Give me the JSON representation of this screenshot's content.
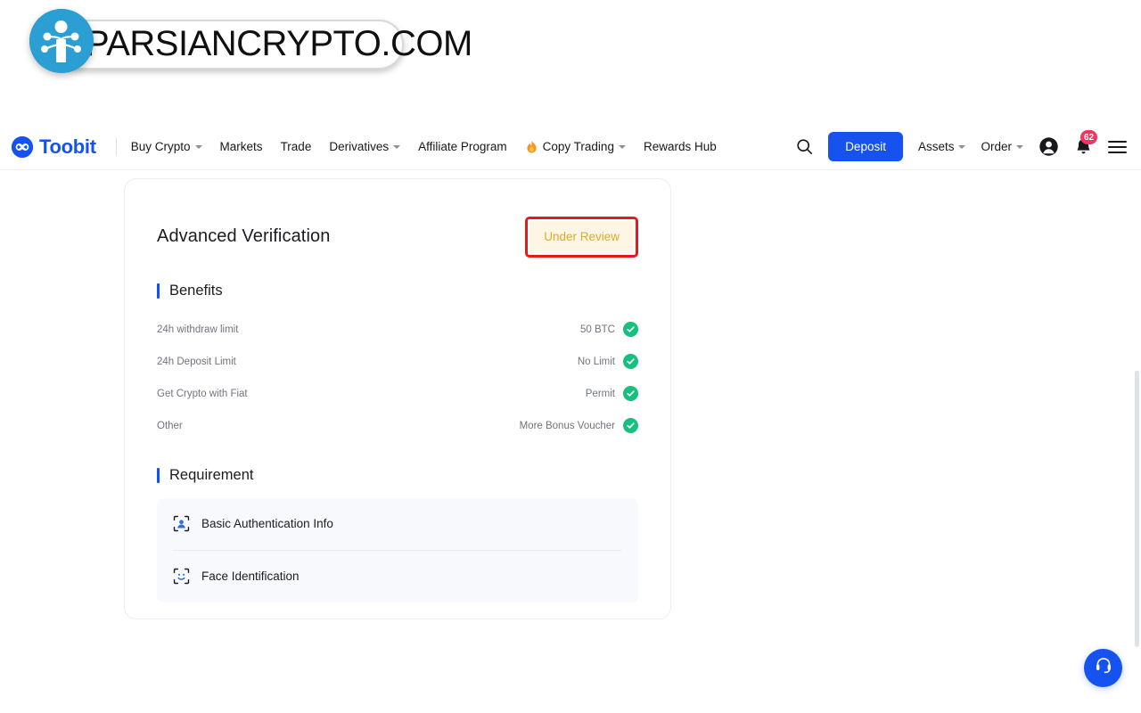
{
  "watermark": {
    "text": "PARSIANCRYPTO.COM",
    "icon": "crypto-tree-logo-icon",
    "circle_color": "#2b9fd4"
  },
  "navbar": {
    "brand": {
      "name": "Toobit",
      "icon": "toobit-logo-icon",
      "color": "#1652f0"
    },
    "links": [
      {
        "label": "Buy Crypto",
        "has_caret": true,
        "icon": null
      },
      {
        "label": "Markets",
        "has_caret": false,
        "icon": null
      },
      {
        "label": "Trade",
        "has_caret": false,
        "icon": null
      },
      {
        "label": "Derivatives",
        "has_caret": true,
        "icon": null
      },
      {
        "label": "Affiliate Program",
        "has_caret": false,
        "icon": null
      },
      {
        "label": "Copy Trading",
        "has_caret": true,
        "icon": "flame-icon"
      },
      {
        "label": "Rewards Hub",
        "has_caret": false,
        "icon": null
      }
    ],
    "right": {
      "search_icon": "search-icon",
      "deposit_label": "Deposit",
      "assets_label": "Assets",
      "order_label": "Order",
      "account_icon": "user-avatar-icon",
      "bell_icon": "notification-bell-icon",
      "notification_count": "62",
      "menu_icon": "hamburger-menu-icon"
    }
  },
  "card": {
    "title": "Advanced Verification",
    "status": "Under Review",
    "status_color": "#dcab2b",
    "status_bg": "#fdf6e5",
    "highlight_color": "#e01b1b",
    "benefits": {
      "heading": "Benefits",
      "rows": [
        {
          "label": "24h withdraw limit",
          "value": "50 BTC",
          "icon": "check-circle-icon"
        },
        {
          "label": "24h Deposit Limit",
          "value": "No Limit",
          "icon": "check-circle-icon"
        },
        {
          "label": "Get Crypto with Fiat",
          "value": "Permit",
          "icon": "check-circle-icon"
        },
        {
          "label": "Other",
          "value": "More Bonus Voucher",
          "icon": "check-circle-icon"
        }
      ]
    },
    "requirement": {
      "heading": "Requirement",
      "rows": [
        {
          "label": "Basic Authentication Info",
          "icon": "id-scan-person-icon"
        },
        {
          "label": "Face Identification",
          "icon": "face-scan-icon"
        }
      ]
    }
  },
  "support": {
    "icon": "headset-support-icon",
    "color": "#1652f0"
  }
}
